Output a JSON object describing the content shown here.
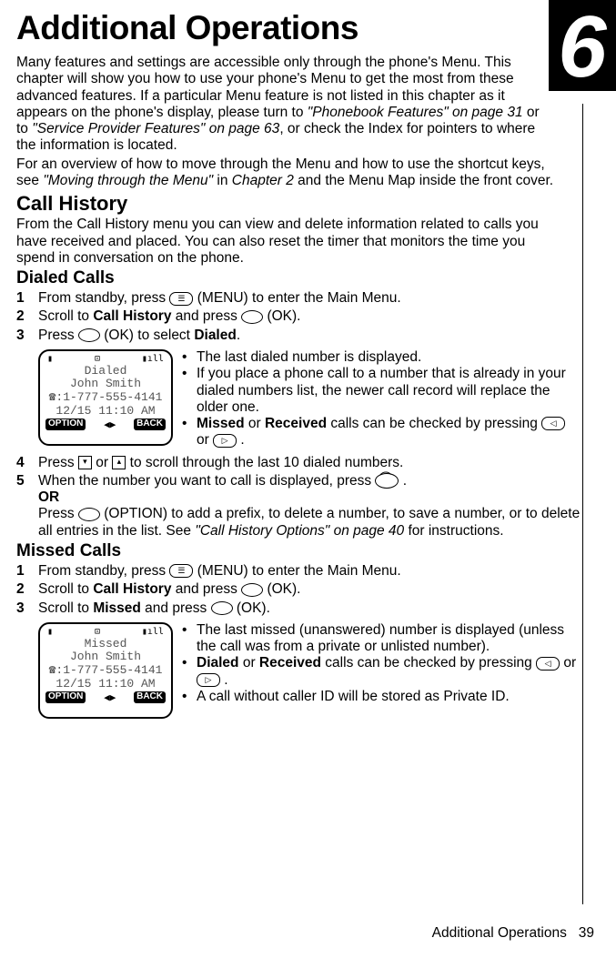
{
  "chapter_number": "6",
  "title": "Additional Operations",
  "intro_part1": "Many features and settings are accessible only through the phone's Menu. This chapter will show you how to use your phone's Menu to get the most from these advanced features. If a particular Menu feature is not listed in this chapter as it appears on the phone's display, please turn to ",
  "intro_ref1": "\"Phonebook Features\" on page 31",
  "intro_part2": " or to ",
  "intro_ref2": "\"Service Provider Features\" on page 63",
  "intro_part3": ", or check the Index for pointers to where the information is located.",
  "intro2_part1": "For an overview of how to move through the Menu and how to use the shortcut keys, see ",
  "intro2_ref1": "\"Moving through the Menu\"",
  "intro2_part2": " in ",
  "intro2_ref2": "Chapter 2",
  "intro2_part3": " and the Menu Map inside the front cover.",
  "section1": "Call History",
  "section1_desc": "From the Call History menu you can view and delete information related to calls you have received and placed. You can also reset the timer that monitors the time you spend in conversation on the phone.",
  "subsection1": "Dialed Calls",
  "dialed": {
    "step1": {
      "num": "1",
      "text_a": "From standby, press ",
      "text_b": " (MENU) to enter the Main Menu."
    },
    "step2": {
      "num": "2",
      "text_a": "Scroll to ",
      "bold": "Call History",
      "text_b": " and press ",
      "text_c": " (OK)."
    },
    "step3": {
      "num": "3",
      "text_a": "Press ",
      "text_b": " (OK) to select ",
      "bold": "Dialed",
      "text_c": "."
    },
    "screen": {
      "title": "Dialed",
      "name": "John Smith",
      "number": "1-777-555-4141",
      "datetime": "12/15 11:10 AM",
      "soft_left": "OPTION",
      "soft_right": "BACK"
    },
    "bullets": {
      "b1": "The last dialed number is displayed.",
      "b2": "If you place a phone call to a number that is already in your dialed numbers list, the newer call record will replace the older one.",
      "b3_a": "",
      "b3_bold1": "Missed",
      "b3_b": " or ",
      "b3_bold2": "Received",
      "b3_c": " calls can be checked by pressing ",
      "b3_d": " or ",
      "b3_e": " ."
    },
    "step4": {
      "num": "4",
      "text_a": "Press ",
      "text_b": " or ",
      "text_c": " to scroll through the last 10 dialed numbers."
    },
    "step5": {
      "num": "5",
      "text_a": "When the number you want to call is displayed, press ",
      "text_b": " .",
      "or": "OR",
      "text_c": "Press ",
      "text_d": " (OPTION) to add a prefix, to delete a number, to save a number, or to delete all entries in the list. See ",
      "ref": "\"Call History Options\" on page 40",
      "text_e": " for instructions."
    }
  },
  "subsection2": "Missed Calls",
  "missed": {
    "step1": {
      "num": "1",
      "text_a": "From standby, press ",
      "text_b": " (MENU) to enter the Main Menu."
    },
    "step2": {
      "num": "2",
      "text_a": "Scroll to ",
      "bold": "Call History",
      "text_b": " and press ",
      "text_c": " (OK)."
    },
    "step3": {
      "num": "3",
      "text_a": "Scroll to ",
      "bold": "Missed",
      "text_b": " and press ",
      "text_c": " (OK)."
    },
    "screen": {
      "title": "Missed",
      "name": "John Smith",
      "number": "1-777-555-4141",
      "datetime": "12/15 11:10 AM",
      "soft_left": "OPTION",
      "soft_right": "BACK"
    },
    "bullets": {
      "b1": "The last missed (unanswered) number is displayed (unless the call was from a private or unlisted number).",
      "b2_bold1": "Dialed",
      "b2_a": " or ",
      "b2_bold2": "Received",
      "b2_b": " calls can be checked by pressing ",
      "b2_c": " or ",
      "b2_d": " .",
      "b3": "A call without caller ID will be stored as Private ID."
    }
  },
  "footer": {
    "label": "Additional Operations",
    "page": "39"
  }
}
